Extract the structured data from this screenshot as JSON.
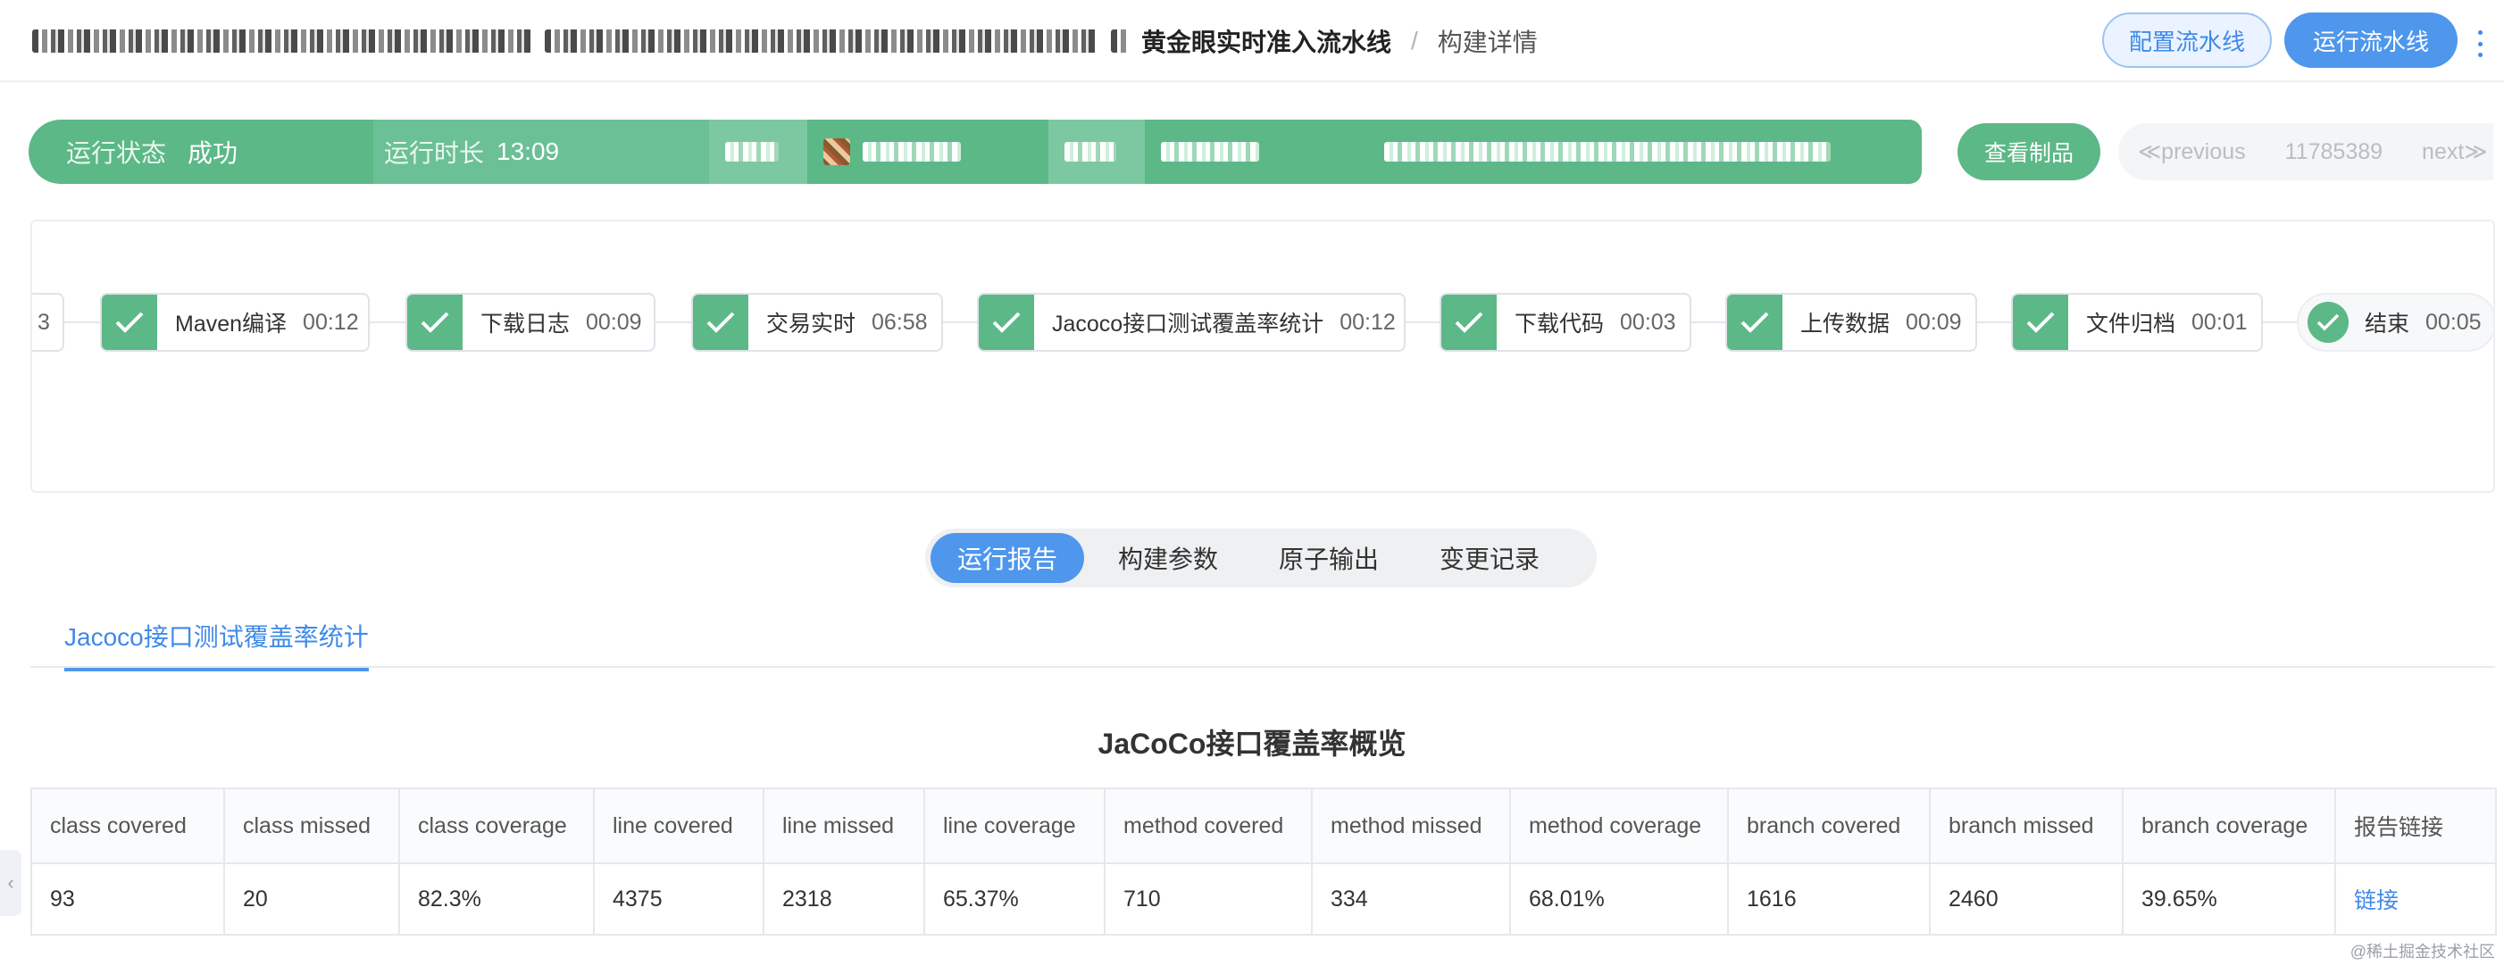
{
  "header": {
    "breadcrumb": {
      "pipeline_name": "黄金眼实时准入流水线",
      "separator": "/",
      "current": "构建详情"
    },
    "configure_label": "配置流水线",
    "run_label": "运行流水线"
  },
  "status": {
    "state_label": "运行状态",
    "state_value": "成功",
    "duration_label": "运行时长",
    "duration_value": "13:09"
  },
  "actions": {
    "view_artifacts_label": "查看制品"
  },
  "pager": {
    "prev_label": "≪previous",
    "build_number": "11785389",
    "next_label": "next≫"
  },
  "stages": [
    {
      "name": "",
      "time": "3"
    },
    {
      "name": "Maven编译",
      "time": "00:12"
    },
    {
      "name": "下载日志",
      "time": "00:09"
    },
    {
      "name": "交易实时",
      "time": "06:58"
    },
    {
      "name": "Jacoco接口测试覆盖率统计",
      "time": "00:12"
    },
    {
      "name": "下载代码",
      "time": "00:03"
    },
    {
      "name": "上传数据",
      "time": "00:09"
    },
    {
      "name": "文件归档",
      "time": "00:01"
    },
    {
      "name": "结束",
      "time": "00:05"
    }
  ],
  "tabs": [
    "运行报告",
    "构建参数",
    "原子输出",
    "变更记录"
  ],
  "subtab": "Jacoco接口测试覆盖率统计",
  "report": {
    "title": "JaCoCo接口覆盖率概览",
    "columns": [
      "class covered",
      "class missed",
      "class coverage",
      "line covered",
      "line missed",
      "line coverage",
      "method covered",
      "method missed",
      "method coverage",
      "branch covered",
      "branch missed",
      "branch coverage",
      "报告链接"
    ],
    "rows": [
      [
        "93",
        "20",
        "82.3%",
        "4375",
        "2318",
        "65.37%",
        "710",
        "334",
        "68.01%",
        "1616",
        "2460",
        "39.65%",
        "链接"
      ]
    ]
  },
  "footer": {
    "watermark": "@稀土掘金技术社区"
  },
  "colors": {
    "success_green": "#5cb887",
    "primary_blue": "#4e97ec"
  }
}
